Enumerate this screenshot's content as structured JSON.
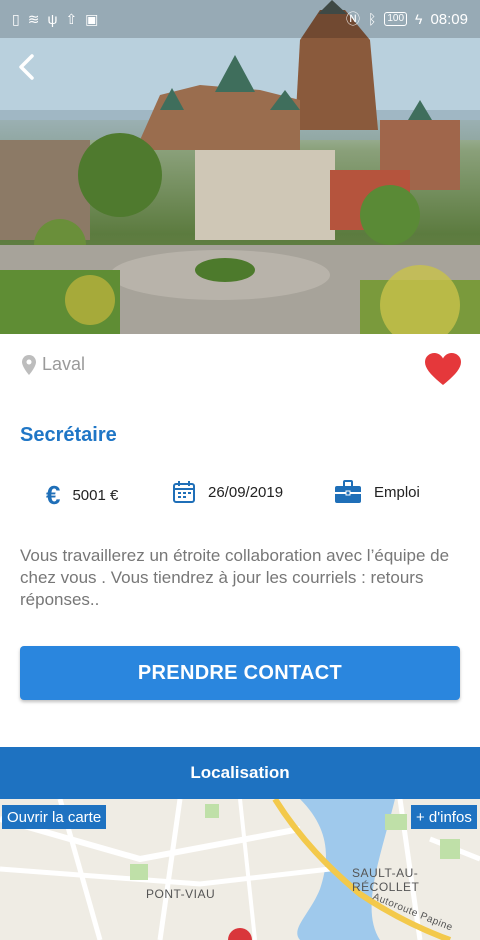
{
  "status_bar": {
    "battery": "100",
    "time": "08:09"
  },
  "listing": {
    "location": "Laval",
    "title": "Secrétaire",
    "salary": "5001 €",
    "date": "26/09/2019",
    "type": "Emploi",
    "description": "Vous travaillerez un étroite collaboration avec l’équipe de chez vous . Vous tiendrez à jour les courriels : retours réponses..",
    "contact_button": "PRENDRE CONTACT"
  },
  "map_section": {
    "header": "Localisation",
    "open_map_button": "Ouvrir la carte",
    "more_info_button": "+ d'infos",
    "labels": {
      "pont_viau": "PONT-VIAU",
      "sault": "SAULT-AU-RÉCOLLET",
      "autoroute": "Autoroute Papine"
    }
  },
  "colors": {
    "accent": "#1e72c1",
    "button": "#2a86de",
    "title": "#1f76c6",
    "heart": "#e5383b",
    "icon_blue": "#1f6fb8"
  },
  "icons": {
    "back": "chevron-left-icon",
    "location": "map-pin-icon",
    "favorite": "heart-icon",
    "salary": "euro-icon",
    "date": "calendar-icon",
    "type": "briefcase-icon"
  }
}
